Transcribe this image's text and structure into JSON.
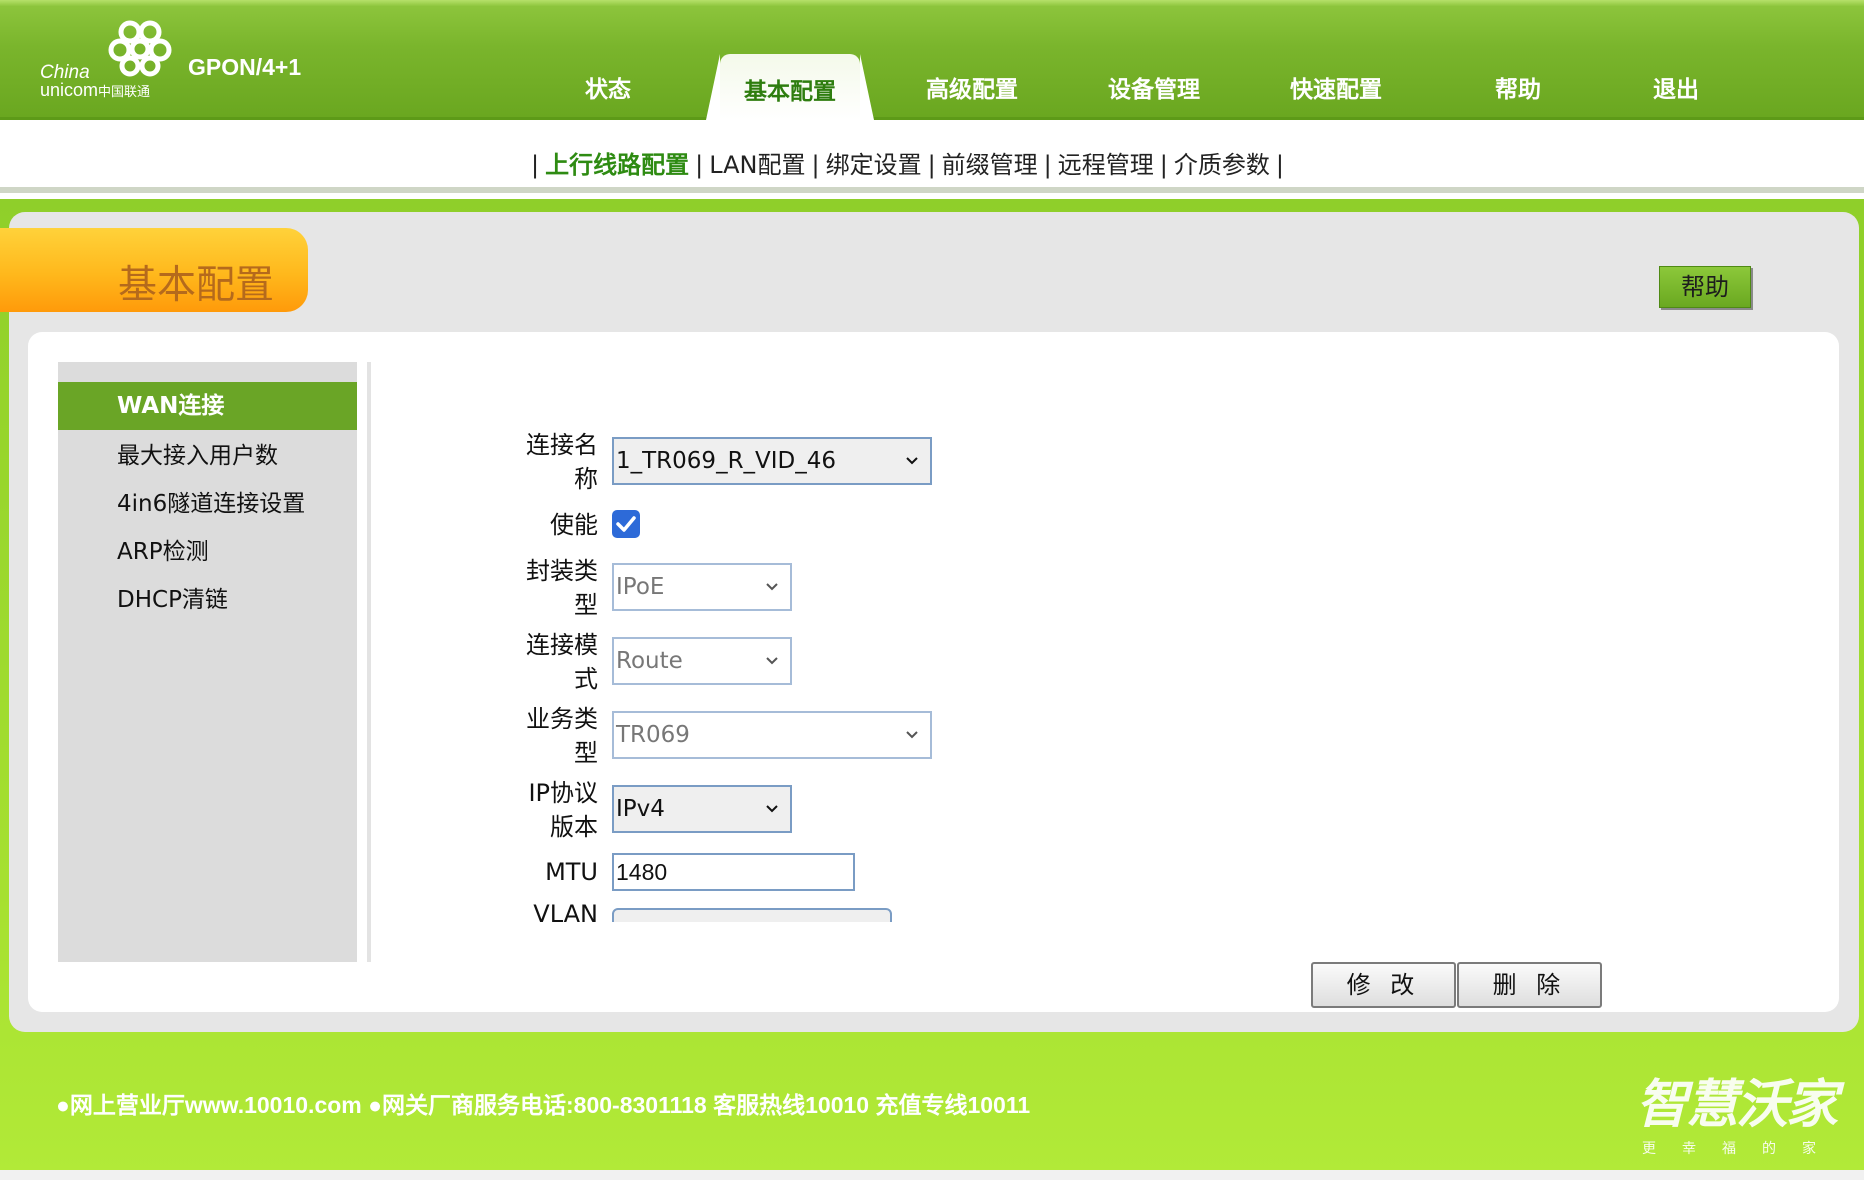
{
  "header": {
    "logo_text_1": "China",
    "logo_text_2a": "unicom",
    "logo_text_2b": "中国联通",
    "model": "GPON/4+1"
  },
  "main_nav": {
    "items": [
      {
        "label": "状态"
      },
      {
        "label": "基本配置"
      },
      {
        "label": "高级配置"
      },
      {
        "label": "设备管理"
      },
      {
        "label": "快速配置"
      },
      {
        "label": "帮助"
      },
      {
        "label": "退出"
      }
    ],
    "active": "基本配置"
  },
  "sub_nav": {
    "items": [
      {
        "label": "上行线路配置"
      },
      {
        "label": "LAN配置"
      },
      {
        "label": "绑定设置"
      },
      {
        "label": "前缀管理"
      },
      {
        "label": "远程管理"
      },
      {
        "label": "介质参数"
      }
    ],
    "separator": "|",
    "active": "上行线路配置"
  },
  "page": {
    "title": "基本配置",
    "help_label": "帮助"
  },
  "left_menu": {
    "items": [
      {
        "label": "WAN连接"
      },
      {
        "label": "最大接入用户数"
      },
      {
        "label": "4in6隧道连接设置"
      },
      {
        "label": "ARP检测"
      },
      {
        "label": "DHCP清链"
      }
    ],
    "active": "WAN连接"
  },
  "form": {
    "connection_name_label_1": "连接名",
    "connection_name_label_2": "称",
    "connection_name_value": "1_TR069_R_VID_46",
    "enable_label": "使能",
    "enable_checked": true,
    "encap_label_1": "封装类",
    "encap_label_2": "型",
    "encap_value": "IPoE",
    "mode_label_1": "连接模",
    "mode_label_2": "式",
    "mode_value": "Route",
    "service_label_1": "业务类",
    "service_label_2": "型",
    "service_value": "TR069",
    "ipver_label_1": "IP协议",
    "ipver_label_2": "版本",
    "ipver_value": "IPv4",
    "mtu_label": "MTU",
    "mtu_value": "1480",
    "vlan_label": "VLAN",
    "modify_label": "修 改",
    "delete_label": "删 除"
  },
  "footer": {
    "text": "●网上营业厅www.10010.com ●网关厂商服务电话:800-8301118 客服热线10010 充值专线10011",
    "brand_main": "智慧沃家",
    "brand_sub": "更幸福的家"
  },
  "colors": {
    "header_green": "#7ab52c",
    "active_menu_green": "#6aa526",
    "active_sub_link": "#2e8b12",
    "title_tab_orange": "#ffb81c",
    "checkbox_blue": "#2d6ad8"
  }
}
